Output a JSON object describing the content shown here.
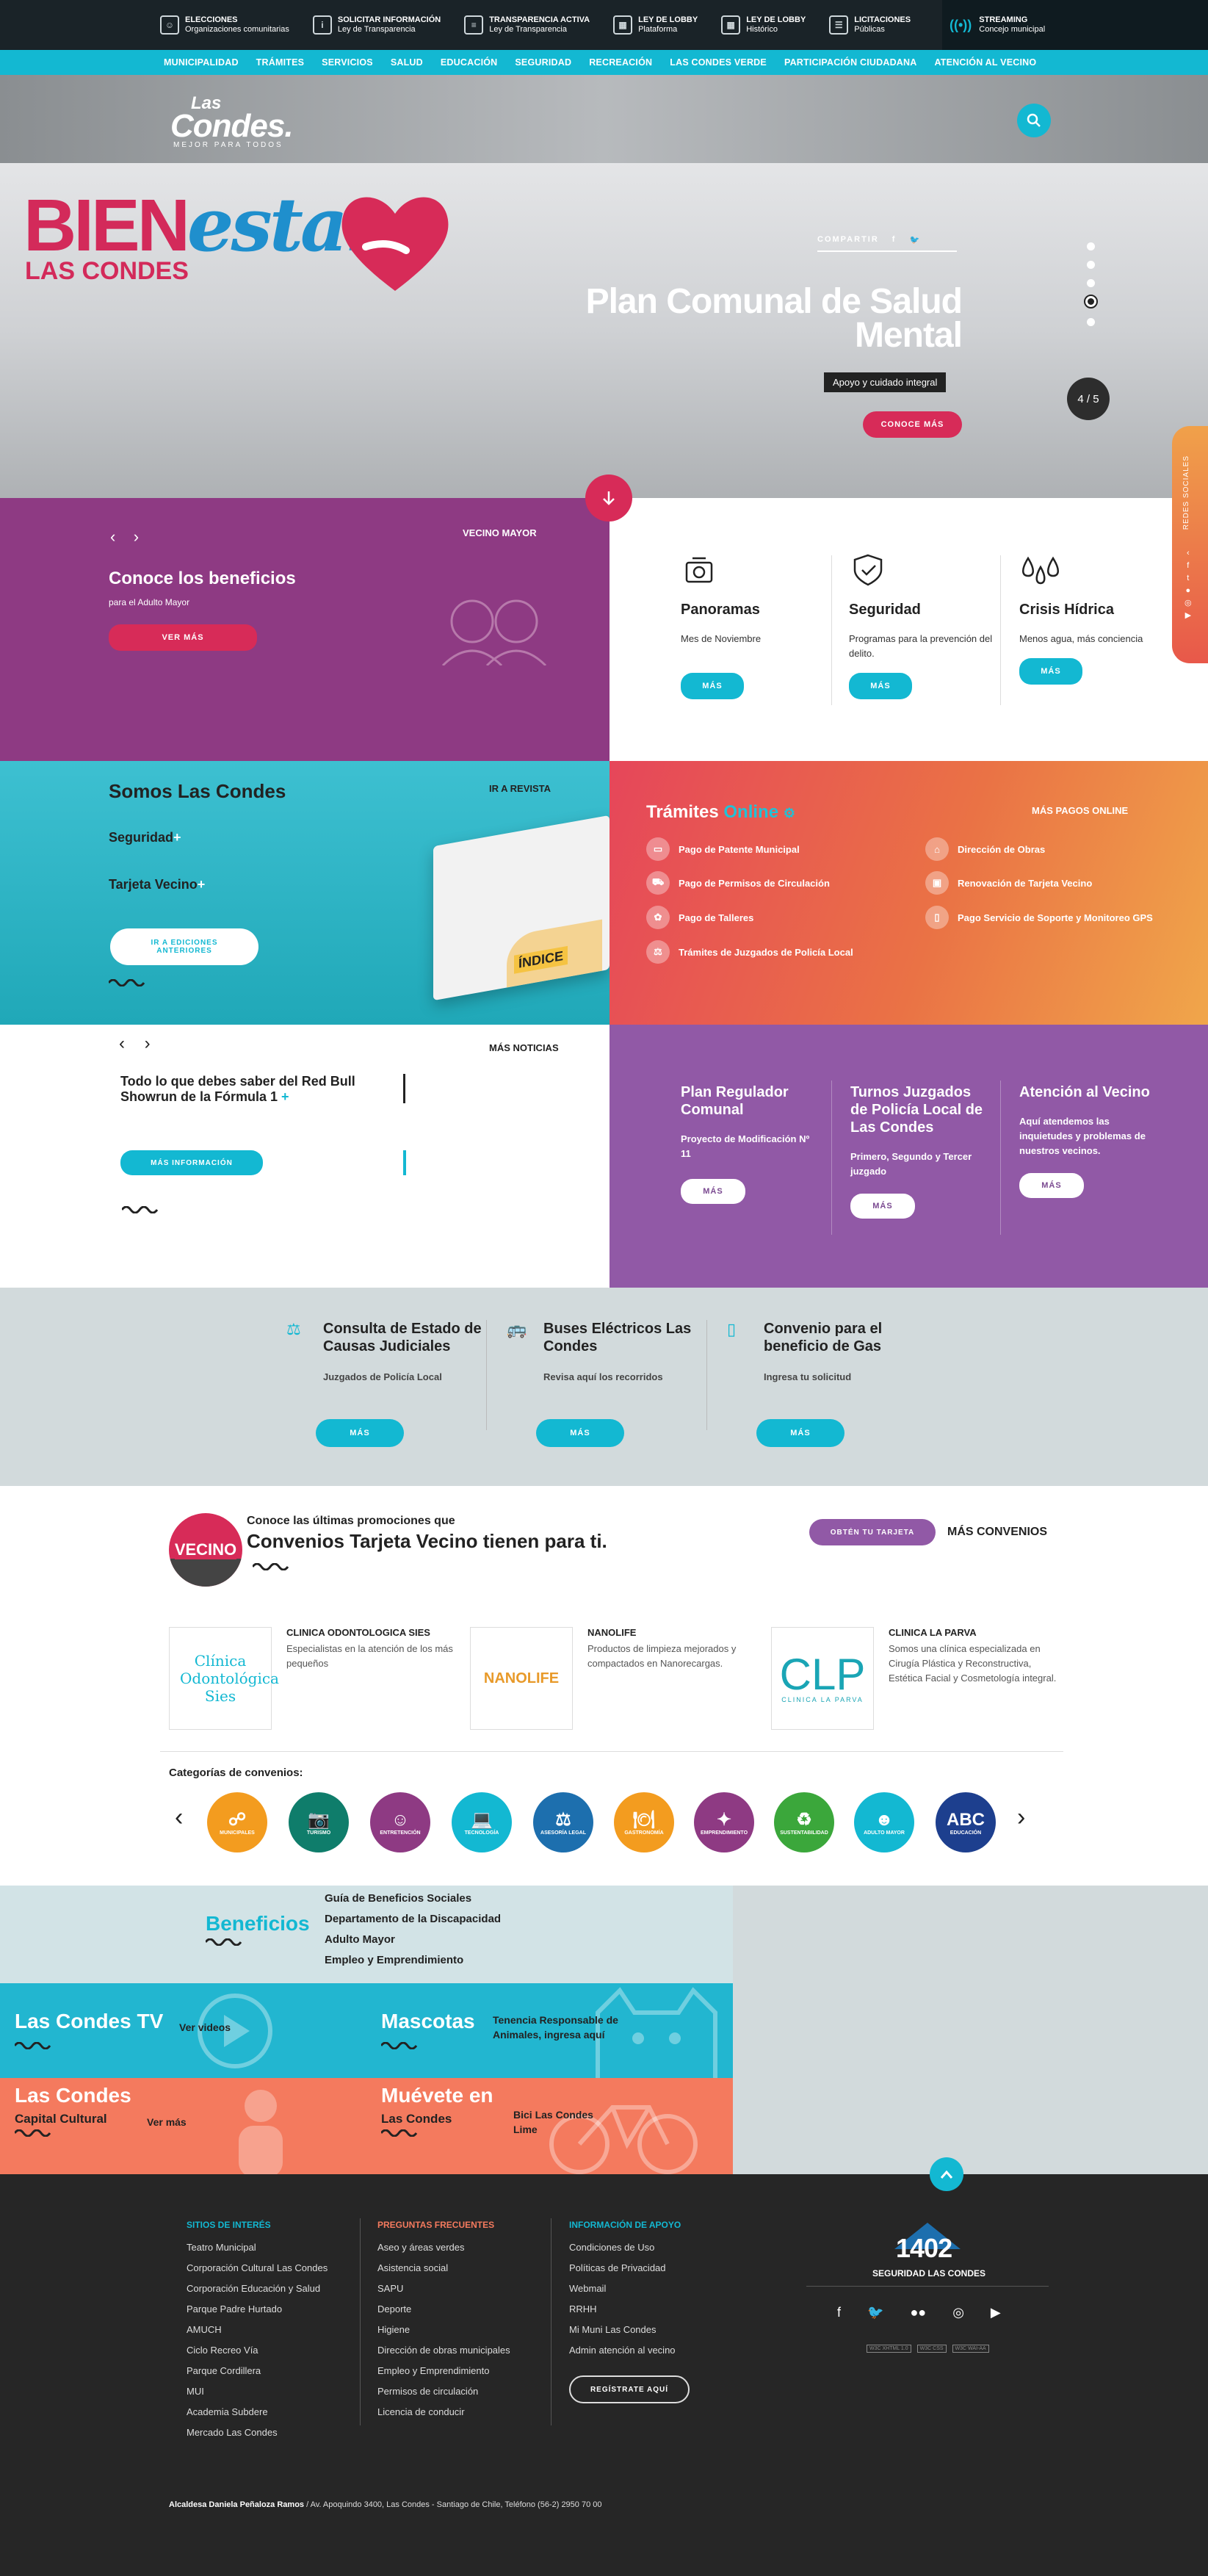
{
  "topbar": {
    "items": [
      {
        "title": "ELECCIONES",
        "sub": "Organizaciones comunitarias",
        "icon": "users-icon"
      },
      {
        "title": "SOLICITAR INFORMACIÓN",
        "sub": "Ley de Transparencia",
        "icon": "info-icon"
      },
      {
        "title": "TRANSPARENCIA ACTIVA",
        "sub": "Ley de Transparencia",
        "icon": "document-icon"
      },
      {
        "title": "LEY DE LOBBY",
        "sub": "Plataforma",
        "icon": "calendar-icon"
      },
      {
        "title": "LEY DE LOBBY",
        "sub": "Histórico",
        "icon": "calendar-icon"
      },
      {
        "title": "LICITACIONES",
        "sub": "Públicas",
        "icon": "list-icon"
      }
    ],
    "streaming": {
      "title": "STREAMING",
      "sub": "Concejo municipal"
    }
  },
  "nav": [
    "MUNICIPALIDAD",
    "TRÁMITES",
    "SERVICIOS",
    "SALUD",
    "EDUCACIÓN",
    "SEGURIDAD",
    "RECREACIÓN",
    "LAS CONDES VERDE",
    "PARTICIPACIÓN CIUDADANA",
    "ATENCIÓN AL VECINO"
  ],
  "logo": {
    "line1": "Las",
    "line2": "Condes.",
    "line3": "MEJOR PARA TODOS"
  },
  "hero": {
    "brand_a": "BIEN",
    "brand_b": "estar",
    "brand_c": "LAS CONDES",
    "share": "COMPARTIR",
    "title": "Plan Comunal de Salud Mental",
    "subtitle": "Apoyo y cuidado integral",
    "cta": "CONOCE MÁS",
    "counter": "4 / 5",
    "social_tab": "REDES SOCIALES"
  },
  "vecino": {
    "tag": "VECINO MAYOR",
    "title": "Conoce los beneficios",
    "sub": "para el Adulto Mayor",
    "cta": "VER MÁS"
  },
  "services": [
    {
      "title": "Panoramas",
      "desc": "Mes de Noviembre",
      "cta": "MÁS"
    },
    {
      "title": "Seguridad",
      "desc": "Programas para la prevención del delito.",
      "cta": "MÁS"
    },
    {
      "title": "Crisis Hídrica",
      "desc": "Menos agua, más conciencia",
      "cta": "MÁS"
    }
  ],
  "somos": {
    "title": "Somos Las Condes",
    "link": "IR A REVISTA",
    "item1": "Seguridad",
    "item2": "Tarjeta Vecino",
    "cta": "IR A EDICIONES ANTERIORES",
    "magazine": "ÍNDICE"
  },
  "tramites": {
    "title_a": "Trámites",
    "title_b": "Online",
    "more": "MÁS PAGOS ONLINE",
    "items": [
      "Pago de Patente Municipal",
      "Pago de Permisos de Circulación",
      "Pago de Talleres",
      "Trámites de Juzgados de Policía Local",
      "Dirección de Obras",
      "Renovación de Tarjeta Vecino",
      "Pago Servicio de Soporte y Monitoreo GPS"
    ]
  },
  "news": {
    "link": "MÁS NOTICIAS",
    "title": "Todo lo que debes saber del Red Bull Showrun de la Fórmula 1",
    "cta": "MÁS INFORMACIÓN"
  },
  "plan": [
    {
      "title": "Plan Regulador Comunal",
      "desc": "Proyecto de Modificación Nº 11",
      "cta": "MÁS"
    },
    {
      "title": "Turnos Juzgados de Policía Local de Las Condes",
      "desc": "Primero, Segundo y Tercer juzgado",
      "cta": "MÁS"
    },
    {
      "title": "Atención al Vecino",
      "desc": "Aquí atendemos las inquietudes y problemas de nuestros vecinos.",
      "cta": "MÁS"
    }
  ],
  "consultas": [
    {
      "title": "Consulta de Estado de Causas Judiciales",
      "desc": "Juzgados de Policía Local",
      "cta": "MÁS"
    },
    {
      "title": "Buses Eléctricos Las Condes",
      "desc": "Revisa aquí los recorridos",
      "cta": "MÁS"
    },
    {
      "title": "Convenio para el beneficio de Gas",
      "desc": "Ingresa tu solicitud",
      "cta": "MÁS"
    }
  ],
  "convenios": {
    "badge": "VECINO",
    "pre": "Conoce las últimas promociones que",
    "title": "Convenios Tarjeta Vecino tienen para ti.",
    "cta": "OBTÉN TU TARJETA",
    "more": "MÁS CONVENIOS",
    "cards": [
      {
        "name": "CLINICA ODONTOLOGICA SIES",
        "desc": "Especialistas en la atención de los más pequeños",
        "logo": "Clínica Odontológica Sies"
      },
      {
        "name": "NANOLIFE",
        "desc": "Productos de limpieza mejorados y compactados en Nanorecargas.",
        "logo": "NANOLIFE"
      },
      {
        "name": "CLINICA LA PARVA",
        "desc": "Somos una clínica especializada en Cirugía Plástica y Reconstructiva, Estética Facial y Cosmetología integral.",
        "logo": "CLP",
        "logo_sub": "CLINICA LA PARVA"
      }
    ],
    "categories_title": "Categorías de convenios:",
    "categories": [
      {
        "label": "MUNICIPALES",
        "color": "#f39c1f",
        "icon": "☍"
      },
      {
        "label": "TURISMO",
        "color": "#0f7d6b",
        "icon": "📷"
      },
      {
        "label": "ENTRETENCIÓN",
        "color": "#8e3a83",
        "icon": "☺"
      },
      {
        "label": "TECNOLOGÍA",
        "color": "#13b8d2",
        "icon": "💻"
      },
      {
        "label": "ASESORÍA LEGAL",
        "color": "#1d6fae",
        "icon": "⚖"
      },
      {
        "label": "GASTRONOMÍA",
        "color": "#f39c1f",
        "icon": "🍽"
      },
      {
        "label": "EMPRENDIMIENTO",
        "color": "#8e3a83",
        "icon": "✦"
      },
      {
        "label": "SUSTENTABILIDAD",
        "color": "#3ba73b",
        "icon": "♻"
      },
      {
        "label": "ADULTO MAYOR",
        "color": "#13b8d2",
        "icon": "☻"
      },
      {
        "label": "EDUCACIÓN",
        "color": "#1d3f8e",
        "icon": "ABC"
      }
    ]
  },
  "beneficios": {
    "title": "Beneficios",
    "links": [
      "Guía de Beneficios Sociales",
      "Departamento de la Discapacidad",
      "Adulto Mayor",
      "Empleo y Emprendimiento"
    ]
  },
  "tiles": [
    {
      "title": "Las Condes TV",
      "desc": "Ver videos",
      "sub": ""
    },
    {
      "title": "Mascotas",
      "desc": "Tenencia Responsable de Animales, ingresa aquí",
      "sub": ""
    },
    {
      "title": "Las Condes",
      "sub": "Capital Cultural",
      "desc": "Ver más"
    },
    {
      "title": "Muévete en",
      "sub": "Las Condes",
      "desc": "Bici Las Condes Lime"
    }
  ],
  "footer": {
    "col1": {
      "title": "SITIOS DE INTERÉS",
      "items": [
        "Teatro Municipal",
        "Corporación Cultural Las Condes",
        "Corporación Educación y Salud",
        "Parque Padre Hurtado",
        "AMUCH",
        "Ciclo Recreo Vía",
        "Parque Cordillera",
        "MUI",
        "Academia Subdere",
        "Mercado Las Condes"
      ]
    },
    "col2": {
      "title": "PREGUNTAS FRECUENTES",
      "items": [
        "Aseo y áreas verdes",
        "Asistencia social",
        "SAPU",
        "Deporte",
        "Higiene",
        "Dirección de obras municipales",
        "Empleo y Emprendimiento",
        "Permisos de circulación",
        "Licencia de conducir"
      ]
    },
    "col3": {
      "title": "INFORMACIÓN DE APOYO",
      "items": [
        "Condiciones de Uso",
        "Políticas de Privacidad",
        "Webmail",
        "RRHH",
        "Mi Muni Las Condes",
        "Admin atención al vecino"
      ],
      "cta": "REGÍSTRATE AQUÍ"
    },
    "emergency": {
      "number": "1402",
      "label": "SEGURIDAD LAS CONDES"
    },
    "badges": [
      "W3C XHTML 1.0",
      "W3C CSS",
      "W3C WAI-AA"
    ],
    "bottom_bold": "Alcaldesa Daniela Peñaloza Ramos",
    "bottom": " / Av. Apoquindo 3400, Las Condes - Santiago de Chile, Teléfono (56-2) 2950 70 00"
  },
  "colors": {
    "accent": "#13b8d2",
    "pink": "#d72b58",
    "purple": "#8e3a83"
  }
}
